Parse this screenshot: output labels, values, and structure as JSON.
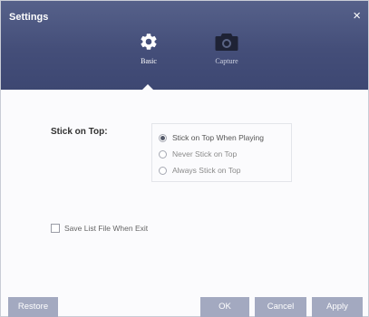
{
  "window": {
    "title": "Settings",
    "close_glyph": "×"
  },
  "tabs": [
    {
      "label": "Basic",
      "icon": "gear-icon",
      "active": true
    },
    {
      "label": "Capture",
      "icon": "camera-icon",
      "active": false
    }
  ],
  "stick_on_top": {
    "label": "Stick on Top:",
    "options": [
      {
        "label": "Stick on Top When Playing",
        "selected": true
      },
      {
        "label": "Never Stick on Top",
        "selected": false
      },
      {
        "label": "Always Stick on Top",
        "selected": false
      }
    ]
  },
  "save_list": {
    "label": "Save List File When Exit",
    "checked": false
  },
  "buttons": {
    "restore": "Restore",
    "ok": "OK",
    "cancel": "Cancel",
    "apply": "Apply"
  },
  "colors": {
    "header": "#444e79",
    "button": "#a3a9c0",
    "background": "#fbfbfd"
  }
}
